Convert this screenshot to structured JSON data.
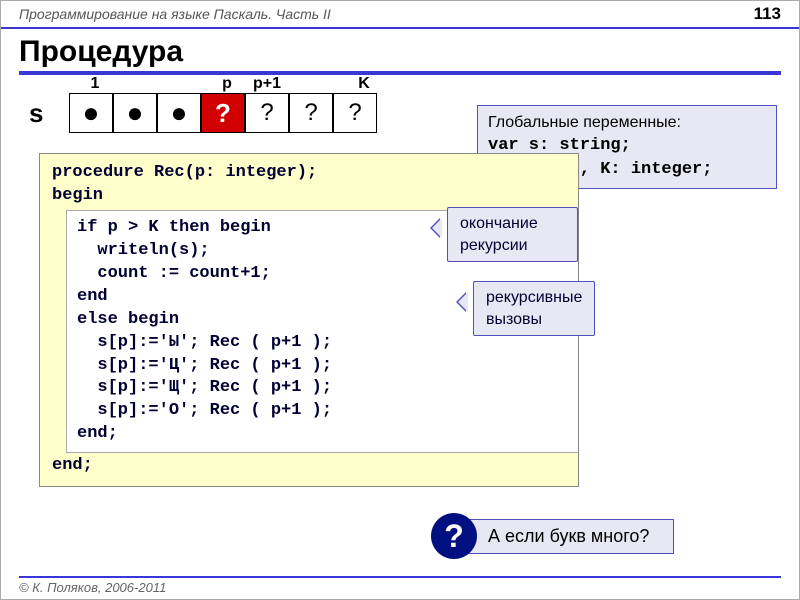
{
  "header": {
    "course_title": "Программирование на языке Паскаль. Часть II",
    "page_number": "113"
  },
  "title": "Процедура",
  "array": {
    "s_label": "s",
    "labels": {
      "l1": "1",
      "lp": "p",
      "lp1": "p+1",
      "lk": "K"
    },
    "cells": {
      "dot": "●",
      "red_q": "?",
      "q": "?"
    }
  },
  "globals": {
    "heading": "Глобальные переменные:",
    "line1": "var s: string;",
    "line2": "    count, K: integer;"
  },
  "code": {
    "l1": "procedure Rec(p: integer);",
    "l2": "begin",
    "l3": "if p > K then begin",
    "l4": "  writeln(s);",
    "l5": "  count := count+1;",
    "l6": "end",
    "l7": "else begin",
    "l8": "  s[p]:='Ы'; Rec ( p+1 );",
    "l9": "  s[p]:='Ц'; Rec ( p+1 );",
    "l10": "  s[p]:='Щ'; Rec ( p+1 );",
    "l11": "  s[p]:='О'; Rec ( p+1 );",
    "l12": "end;",
    "l13": "end;"
  },
  "callouts": {
    "c1": "окончание рекурсии",
    "c2": "рекурсивные вызовы"
  },
  "question": {
    "badge": "?",
    "text": "А если букв много?"
  },
  "footer": "© К. Поляков, 2006-2011"
}
